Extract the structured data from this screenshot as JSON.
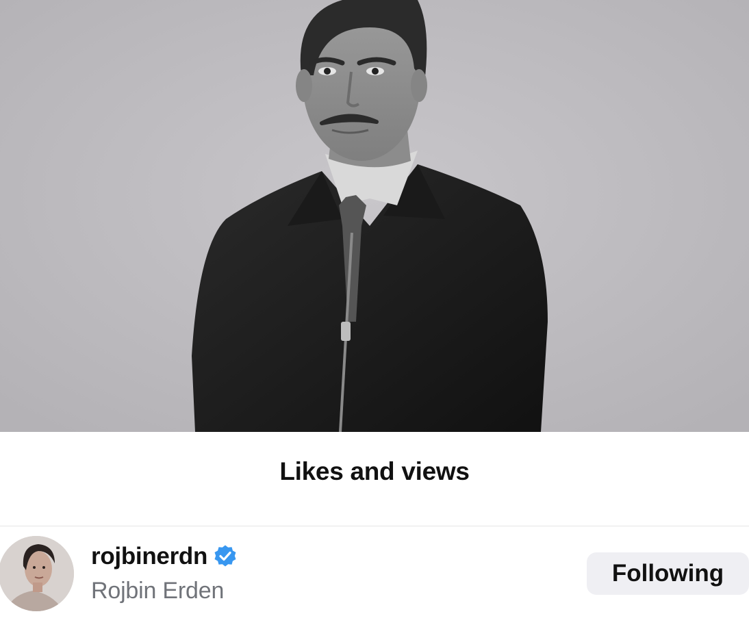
{
  "sheet": {
    "title": "Likes and views"
  },
  "user": {
    "username": "rojbinerdn",
    "full_name": "Rojbin Erden",
    "verified": true,
    "follow_button_label": "Following"
  },
  "icons": {
    "verified": "verified-badge-icon"
  },
  "colors": {
    "verified_badge": "#3897f0",
    "follow_button_bg": "#efeff3",
    "secondary_text": "#707379"
  }
}
